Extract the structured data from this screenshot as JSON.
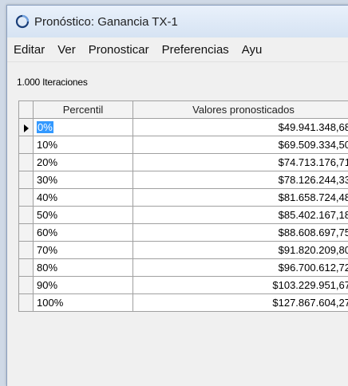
{
  "window": {
    "title": "Pronóstico: Ganancia TX-1"
  },
  "menu": {
    "items": [
      "Editar",
      "Ver",
      "Pronosticar",
      "Preferencias",
      "Ayu"
    ]
  },
  "iterations_label": "1.000 Iteraciones",
  "table": {
    "headers": {
      "percentile": "Percentil",
      "value": "Valores pronosticados"
    },
    "selected_row": 0,
    "rows": [
      {
        "percentile": "0%",
        "value": "$49.941.348,68"
      },
      {
        "percentile": "10%",
        "value": "$69.509.334,50"
      },
      {
        "percentile": "20%",
        "value": "$74.713.176,71"
      },
      {
        "percentile": "30%",
        "value": "$78.126.244,33"
      },
      {
        "percentile": "40%",
        "value": "$81.658.724,48"
      },
      {
        "percentile": "50%",
        "value": "$85.402.167,18"
      },
      {
        "percentile": "60%",
        "value": "$88.608.697,75"
      },
      {
        "percentile": "70%",
        "value": "$91.820.209,80"
      },
      {
        "percentile": "80%",
        "value": "$96.700.612,72"
      },
      {
        "percentile": "90%",
        "value": "$103.229.951,67"
      },
      {
        "percentile": "100%",
        "value": "$127.867.604,27"
      }
    ]
  },
  "colors": {
    "selection": "#3399ff"
  }
}
